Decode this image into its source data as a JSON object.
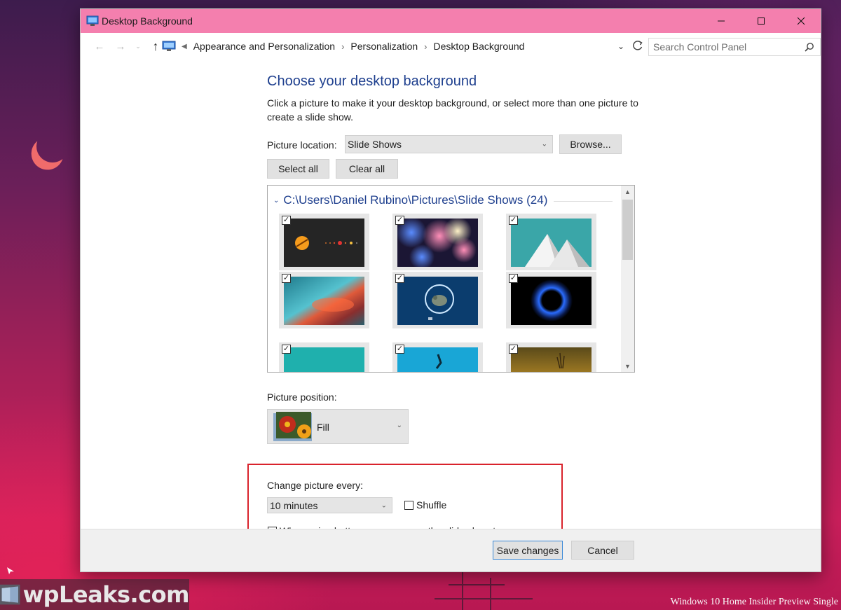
{
  "window": {
    "title": "Desktop Background",
    "colors": {
      "titlebar": "#f47fae",
      "heading": "#1e3f8e",
      "highlight_border": "#d9232c"
    }
  },
  "address_bar": {
    "breadcrumbs": [
      "Appearance and Personalization",
      "Personalization",
      "Desktop Background"
    ],
    "search_placeholder": "Search Control Panel"
  },
  "main": {
    "heading": "Choose your desktop background",
    "description": "Click a picture to make it your desktop background, or select more than one picture to create a slide show.",
    "picture_location_label": "Picture location:",
    "picture_location_value": "Slide Shows",
    "browse_label": "Browse...",
    "select_all_label": "Select all",
    "clear_all_label": "Clear all",
    "gallery_group_title": "C:\\Users\\Daniel Rubino\\Pictures\\Slide Shows (24)",
    "thumbnails": [
      {
        "icon": "planet-orbit-wallpaper",
        "checked": true
      },
      {
        "icon": "bokeh-lights-wallpaper",
        "checked": true
      },
      {
        "icon": "white-mountains-teal-wallpaper",
        "checked": true
      },
      {
        "icon": "teal-red-blur-wallpaper",
        "checked": true
      },
      {
        "icon": "ninja-cat-dinosaur-wallpaper",
        "checked": true
      },
      {
        "icon": "blue-ring-black-wallpaper",
        "checked": true
      },
      {
        "icon": "teal-solid-wallpaper",
        "checked": true
      },
      {
        "icon": "blue-sky-silhouette-wallpaper",
        "checked": true
      },
      {
        "icon": "golden-field-wallpaper",
        "checked": true
      }
    ],
    "picture_position_label": "Picture position:",
    "picture_position_value": "Fill",
    "change_picture_label": "Change picture every:",
    "change_interval_value": "10 minutes",
    "shuffle_label": "Shuffle",
    "battery_label": "When using battery power, pause the slide show to save power"
  },
  "footer": {
    "save_label": "Save changes",
    "cancel_label": "Cancel"
  },
  "desktop": {
    "watermark_text": "wpLeaks.com",
    "build_text": "Windows 10 Home Insider Preview Single"
  }
}
